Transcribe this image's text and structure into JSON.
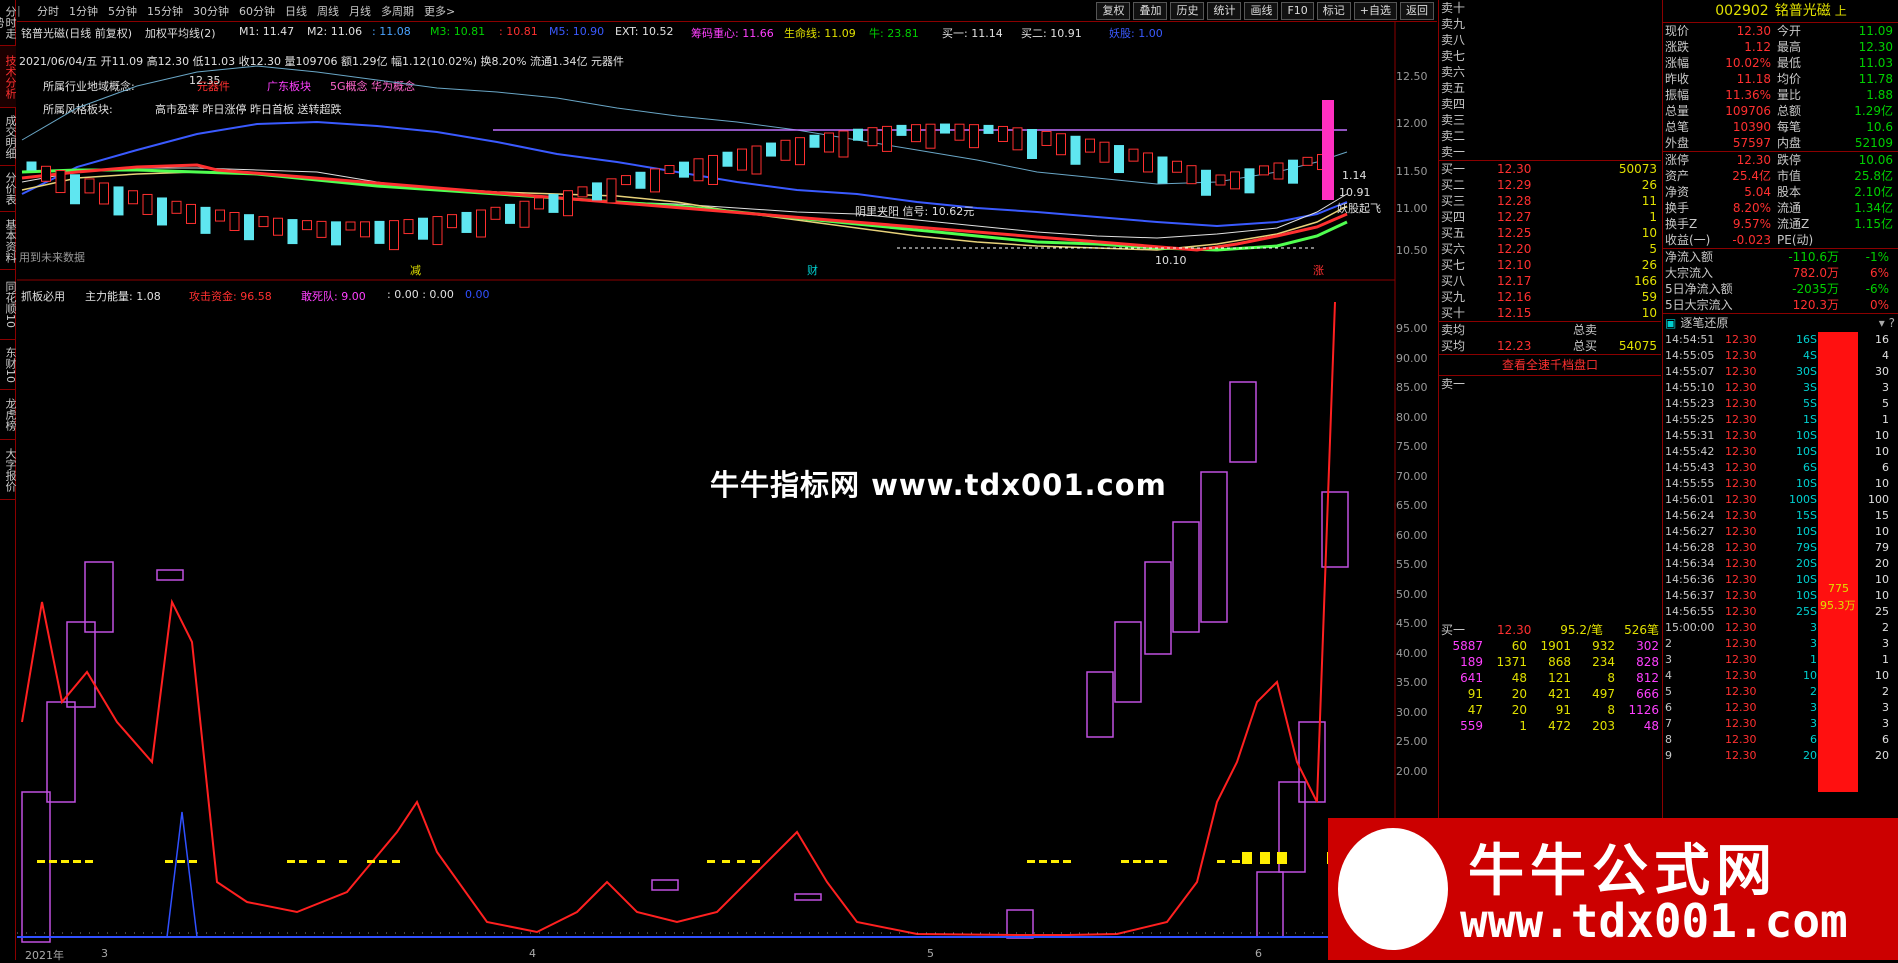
{
  "left_tabs": [
    "分时走势",
    "技术分析",
    "成交明细",
    "分价表",
    "基本资料",
    "同花顺10",
    "东财10",
    "龙虎榜",
    "大字报价"
  ],
  "periods": [
    "分时",
    "1分钟",
    "5分钟",
    "15分钟",
    "30分钟",
    "60分钟",
    "日线",
    "周线",
    "月线",
    "多周期",
    "更多>"
  ],
  "top_buttons": [
    "复权",
    "叠加",
    "历史",
    "统计",
    "画线",
    "F10",
    "标记",
    "+自选",
    "返回"
  ],
  "main_header": {
    "title": "铭普光磁(日线 前复权)",
    "indicator": "加权平均线(2)",
    "m1": "M1: 11.47",
    "m2": "M2: 11.06",
    "m2b": ": 11.08",
    "m3": "M3: 10.81",
    "v1": ": 10.81",
    "v2": "M5: 10.90",
    "ext": "EXT: 10.52",
    "chip": "筹码重心: 11.66",
    "life": "生命线: 11.09",
    "niu": "牛: 23.81",
    "buy1": "买一: 11.14",
    "buy2": "买二: 10.91",
    "yao": "妖股: 1.00"
  },
  "info_line": "2021/06/04/五 开11.09 高12.30 低11.03 收12.30 量109706 额1.29亿 幅1.12(10.02%) 换8.20% 流通1.34亿 元器件",
  "info_lines": {
    "industry": "所属行业地域概念:",
    "industry_val": "元器件",
    "region": "广东板块",
    "concept": "5G概念 华为概念",
    "style": "所属风格板块:",
    "style_val": "高市盈率 昨日涨停 昨日首板 送转超跌"
  },
  "future_data": "用到未来数据",
  "annotations": {
    "high_12_35": "12.35",
    "low_10_10": "10.10",
    "v1_14": "1.14",
    "v10_91": "10.91",
    "yaogu": "妖股起飞",
    "flag_jian": "减",
    "flag_cai": "财",
    "flag_zhang": "涨",
    "ma_label": "阴里夹阳 信号: 10.62元"
  },
  "upper_axis": [
    "12.50",
    "12.00",
    "11.50",
    "11.00",
    "10.50"
  ],
  "sub_header": {
    "title": "抓板必用",
    "power": "主力能量: 1.08",
    "attack": "攻击资金: 96.58",
    "dare": "敢死队: 9.00",
    "v1": ": 0.00 : 0.00",
    "v2": "0.00"
  },
  "lower_axis": [
    "95.00",
    "90.00",
    "85.00",
    "80.00",
    "75.00",
    "70.00",
    "65.00",
    "60.00",
    "55.00",
    "50.00",
    "45.00",
    "40.00",
    "35.00",
    "30.00",
    "25.00",
    "20.00"
  ],
  "x_axis": [
    "2021年",
    "3",
    "4",
    "5",
    "6"
  ],
  "watermark": "牛牛指标网 www.tdx001.com",
  "banner": {
    "title": "牛牛公式网",
    "url": "www.tdx001.com"
  },
  "quote": {
    "code": "002902",
    "name": "铭普光磁",
    "suffix": "上",
    "stats": [
      [
        "现价",
        "12.30",
        "今开",
        "11.09"
      ],
      [
        "涨跌",
        "1.12",
        "最高",
        "12.30"
      ],
      [
        "涨幅",
        "10.02%",
        "最低",
        "11.03"
      ],
      [
        "昨收",
        "11.18",
        "均价",
        "11.78"
      ],
      [
        "振幅",
        "11.36%",
        "量比",
        "1.88"
      ],
      [
        "总量",
        "109706",
        "总额",
        "1.29亿"
      ],
      [
        "总笔",
        "10390",
        "每笔",
        "10.6"
      ],
      [
        "外盘",
        "57597",
        "内盘",
        "52109"
      ]
    ],
    "stats2": [
      [
        "涨停",
        "12.30",
        "跌停",
        "10.06"
      ],
      [
        "资产",
        "25.4亿",
        "市值",
        "25.8亿"
      ],
      [
        "净资",
        "5.04",
        "股本",
        "2.10亿"
      ],
      [
        "换手",
        "8.20%",
        "流通",
        "1.34亿"
      ],
      [
        "换手Z",
        "9.57%",
        "流通Z",
        "1.15亿"
      ],
      [
        "收益(一)",
        "-0.023",
        "PE(动)",
        ""
      ]
    ],
    "flows": [
      [
        "净流入额",
        "-110.6万",
        "-1%"
      ],
      [
        "大宗流入",
        "782.0万",
        "6%"
      ],
      [
        "5日净流入额",
        "-2035万",
        "-6%"
      ],
      [
        "5日大宗流入",
        "120.3万",
        "0%"
      ]
    ]
  },
  "order_book": {
    "sells": [
      "卖十",
      "卖九",
      "卖八",
      "卖七",
      "卖六",
      "卖五",
      "卖四",
      "卖三",
      "卖二",
      "卖一"
    ],
    "buys": [
      [
        "买一",
        "12.30",
        "50073"
      ],
      [
        "买二",
        "12.29",
        "26"
      ],
      [
        "买三",
        "12.28",
        "11"
      ],
      [
        "买四",
        "12.27",
        "1"
      ],
      [
        "买五",
        "12.25",
        "10"
      ],
      [
        "买六",
        "12.20",
        "5"
      ],
      [
        "买七",
        "12.10",
        "26"
      ],
      [
        "买八",
        "12.17",
        "166"
      ],
      [
        "买九",
        "12.16",
        "59"
      ],
      [
        "买十",
        "12.15",
        "10"
      ]
    ],
    "sell_avg": "卖均",
    "total_sell": "总卖",
    "buy_avg": [
      "买均",
      "12.23",
      "总买",
      "54075"
    ],
    "link": "查看全速千档盘口",
    "sell1": "卖一",
    "buy1_row": [
      "买一",
      "12.30",
      "95.2/笔",
      "526笔"
    ],
    "queue": [
      [
        "5887",
        "60",
        "1901",
        "932",
        "302"
      ],
      [
        "189",
        "1371",
        "868",
        "234",
        "828"
      ],
      [
        "641",
        "48",
        "121",
        "8",
        "812"
      ],
      [
        "91",
        "20",
        "421",
        "497",
        "666"
      ],
      [
        "47",
        "20",
        "91",
        "8",
        "1126"
      ],
      [
        "559",
        "1",
        "472",
        "203",
        "48"
      ]
    ]
  },
  "ticks": {
    "title": "逐笔还原",
    "rows": [
      [
        "14:54:51",
        "12.30",
        "16S",
        "16"
      ],
      [
        "14:55:05",
        "12.30",
        "4S",
        "4"
      ],
      [
        "14:55:07",
        "12.30",
        "30S",
        "30"
      ],
      [
        "14:55:10",
        "12.30",
        "3S",
        "3"
      ],
      [
        "14:55:23",
        "12.30",
        "5S",
        "5"
      ],
      [
        "14:55:25",
        "12.30",
        "1S",
        "1"
      ],
      [
        "14:55:31",
        "12.30",
        "10S",
        "10"
      ],
      [
        "14:55:42",
        "12.30",
        "10S",
        "10"
      ],
      [
        "14:55:43",
        "12.30",
        "6S",
        "6"
      ],
      [
        "14:55:55",
        "12.30",
        "10S",
        "10"
      ],
      [
        "14:56:01",
        "12.30",
        "100S",
        "100"
      ],
      [
        "14:56:24",
        "12.30",
        "15S",
        "15"
      ],
      [
        "14:56:27",
        "12.30",
        "10S",
        "10"
      ],
      [
        "14:56:28",
        "12.30",
        "79S",
        "79"
      ],
      [
        "14:56:34",
        "12.30",
        "20S",
        "20"
      ],
      [
        "14:56:36",
        "12.30",
        "10S",
        "10"
      ],
      [
        "14:56:37",
        "12.30",
        "10S",
        "10"
      ],
      [
        "14:56:55",
        "12.30",
        "25S",
        "25"
      ],
      [
        "15:00:00",
        "12.30",
        "3",
        "2"
      ],
      [
        "2",
        "12.30",
        "3",
        "3"
      ],
      [
        "3",
        "12.30",
        "1",
        "1"
      ],
      [
        "4",
        "12.30",
        "10",
        "10"
      ],
      [
        "5",
        "12.30",
        "2",
        "2"
      ],
      [
        "6",
        "12.30",
        "3",
        "3"
      ],
      [
        "7",
        "12.30",
        "3",
        "3"
      ],
      [
        "8",
        "12.30",
        "6",
        "6"
      ],
      [
        "9",
        "12.30",
        "20",
        "20"
      ]
    ],
    "bar_label1": "775",
    "bar_label2": "95.3万"
  }
}
